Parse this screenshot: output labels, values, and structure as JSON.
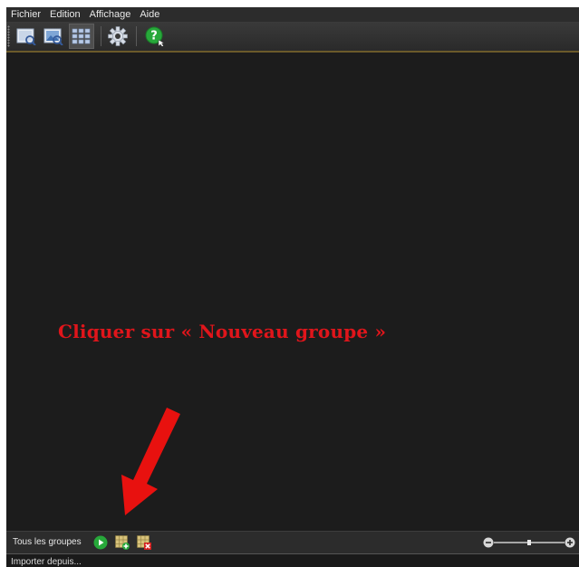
{
  "menubar": {
    "items": [
      {
        "label": "Fichier"
      },
      {
        "label": "Edition"
      },
      {
        "label": "Affichage"
      },
      {
        "label": "Aide"
      }
    ]
  },
  "toolbar": {
    "buttons": [
      {
        "icon": "single-image-view-icon",
        "active": false
      },
      {
        "icon": "image-preview-icon",
        "active": false
      },
      {
        "icon": "grid-view-icon",
        "active": true
      },
      {
        "icon": "gear-icon",
        "active": false
      },
      {
        "icon": "help-icon",
        "active": false
      }
    ]
  },
  "annotation": {
    "text": "Cliquer sur « Nouveau groupe »",
    "color": "#e0151b"
  },
  "groups_bar": {
    "label": "Tous les groupes",
    "buttons": [
      {
        "icon": "play-icon"
      },
      {
        "icon": "new-group-icon"
      },
      {
        "icon": "delete-group-icon"
      }
    ],
    "zoom_level": 0.5
  },
  "status": {
    "text": "Importer depuis..."
  },
  "colors": {
    "background": "#1c1c1c",
    "bars": "#2c2c2c",
    "accent_green": "#27a83a",
    "arrow_red": "#e8110f",
    "toolbar_border": "#6b5a2a"
  }
}
